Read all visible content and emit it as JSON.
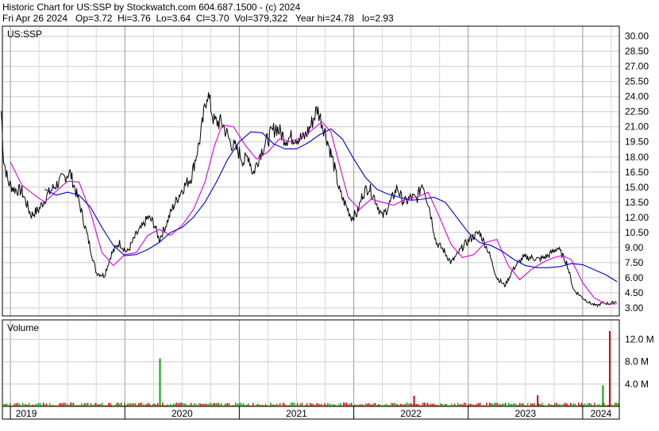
{
  "header": {
    "line1": "Historic Chart for US:SSP by Stockwatch.com 604.687.1500 - (c) 2024",
    "line2": "Fri Apr 26 2024   Op=3.72  Hi=3.76  Lo=3.64  Cl=3.70  Vol=379,322   Year hi=24.78   lo=2.93"
  },
  "chart_data": [
    {
      "type": "line",
      "title": "US:SSP",
      "ylim": [
        2.2,
        31.0
      ],
      "y_ticks": [
        "30.00",
        "28.50",
        "27.00",
        "25.50",
        "24.00",
        "22.50",
        "21.00",
        "19.50",
        "18.00",
        "16.50",
        "15.00",
        "13.50",
        "12.00",
        "10.50",
        "9.00",
        "7.50",
        "6.00",
        "4.50",
        "3.00"
      ],
      "x_labels": [
        "2019",
        "2020",
        "2021",
        "2022",
        "2023",
        "2024"
      ],
      "grid": true,
      "colors": {
        "price": "#000000",
        "ma_short": "#dd00dd",
        "ma_long": "#0000cc"
      },
      "series": [
        {
          "role": "price",
          "x": [
            2018.92,
            2018.94,
            2018.98,
            2019.03,
            2019.1,
            2019.18,
            2019.25,
            2019.32,
            2019.38,
            2019.45,
            2019.52,
            2019.6,
            2019.68,
            2019.75,
            2019.82,
            2019.88,
            2019.95,
            2020.02,
            2020.1,
            2020.15,
            2020.2,
            2020.25,
            2020.3,
            2020.35,
            2020.42,
            2020.5,
            2020.58,
            2020.66,
            2020.72,
            2020.78,
            2020.85,
            2020.92,
            2021.0,
            2021.04,
            2021.08,
            2021.12,
            2021.18,
            2021.25,
            2021.32,
            2021.4,
            2021.48,
            2021.56,
            2021.62,
            2021.68,
            2021.75,
            2021.82,
            2021.88,
            2021.93,
            2021.98,
            2022.03,
            2022.08,
            2022.13,
            2022.18,
            2022.25,
            2022.32,
            2022.38,
            2022.42,
            2022.45,
            2022.5,
            2022.55,
            2022.6,
            2022.66,
            2022.72,
            2022.78,
            2022.85,
            2022.9,
            2022.96,
            2023.03,
            2023.1,
            2023.18,
            2023.25,
            2023.32,
            2023.4,
            2023.48,
            2023.56,
            2023.62,
            2023.7,
            2023.78,
            2023.86,
            2023.92,
            2024.0,
            2024.06,
            2024.12,
            2024.18,
            2024.24,
            2024.3
          ],
          "values": [
            22.6,
            17.8,
            15.5,
            14.8,
            14.6,
            12.2,
            12.8,
            14.2,
            15.0,
            15.8,
            16.5,
            13.5,
            9.8,
            6.5,
            6.2,
            8.3,
            9.5,
            8.5,
            10.3,
            11.0,
            12.0,
            11.5,
            9.8,
            11.0,
            13.0,
            14.8,
            16.0,
            20.0,
            24.5,
            21.5,
            21.4,
            19.5,
            18.4,
            17.5,
            18.2,
            16.3,
            18.3,
            19.8,
            21.0,
            19.8,
            20.0,
            19.8,
            21.0,
            22.8,
            20.5,
            17.5,
            14.4,
            13.2,
            12.0,
            12.4,
            14.4,
            15.0,
            14.0,
            12.0,
            13.5,
            15.0,
            13.8,
            13.5,
            14.0,
            13.8,
            15.5,
            13.0,
            9.5,
            8.8,
            7.5,
            8.2,
            9.2,
            10.0,
            10.5,
            8.5,
            6.0,
            5.2,
            7.0,
            8.0,
            8.0,
            7.8,
            8.2,
            9.0,
            7.5,
            4.8,
            4.0,
            3.5,
            3.2,
            3.5,
            3.4,
            3.7
          ]
        },
        {
          "role": "ma_short",
          "x": [
            2019.0,
            2019.1,
            2019.2,
            2019.3,
            2019.4,
            2019.5,
            2019.6,
            2019.7,
            2019.8,
            2019.9,
            2020.0,
            2020.1,
            2020.2,
            2020.3,
            2020.4,
            2020.5,
            2020.6,
            2020.7,
            2020.78,
            2020.85,
            2020.95,
            2021.05,
            2021.15,
            2021.25,
            2021.35,
            2021.45,
            2021.55,
            2021.65,
            2021.72,
            2021.8,
            2021.88,
            2021.95,
            2022.05,
            2022.15,
            2022.25,
            2022.35,
            2022.45,
            2022.55,
            2022.65,
            2022.75,
            2022.85,
            2022.95,
            2023.05,
            2023.15,
            2023.25,
            2023.35,
            2023.45,
            2023.55,
            2023.65,
            2023.75,
            2023.82,
            2023.9,
            2024.0,
            2024.1,
            2024.2,
            2024.3
          ],
          "values": [
            17.5,
            15.2,
            14.3,
            13.5,
            14.6,
            15.6,
            15.5,
            12.5,
            8.5,
            7.2,
            8.3,
            8.5,
            10.2,
            10.8,
            10.2,
            11.2,
            12.8,
            15.5,
            19.0,
            21.2,
            21.0,
            19.2,
            17.8,
            18.5,
            19.8,
            19.5,
            20.0,
            20.8,
            21.5,
            20.5,
            17.0,
            14.0,
            12.8,
            13.8,
            13.5,
            13.2,
            13.8,
            14.0,
            14.5,
            12.0,
            9.3,
            8.0,
            8.3,
            9.5,
            9.8,
            7.2,
            5.8,
            6.8,
            7.5,
            8.0,
            8.2,
            7.8,
            5.5,
            4.0,
            3.4,
            3.4
          ]
        },
        {
          "role": "ma_long",
          "x": [
            2019.3,
            2019.4,
            2019.5,
            2019.6,
            2019.7,
            2019.8,
            2019.9,
            2020.0,
            2020.1,
            2020.2,
            2020.3,
            2020.4,
            2020.5,
            2020.6,
            2020.7,
            2020.8,
            2020.9,
            2021.0,
            2021.1,
            2021.2,
            2021.3,
            2021.4,
            2021.5,
            2021.6,
            2021.7,
            2021.8,
            2021.9,
            2022.0,
            2022.1,
            2022.2,
            2022.3,
            2022.4,
            2022.5,
            2022.6,
            2022.7,
            2022.8,
            2022.9,
            2023.0,
            2023.1,
            2023.2,
            2023.3,
            2023.4,
            2023.5,
            2023.6,
            2023.7,
            2023.8,
            2023.9,
            2024.0,
            2024.1,
            2024.2,
            2024.3
          ],
          "values": [
            14.8,
            14.2,
            14.5,
            14.2,
            13.0,
            11.0,
            9.2,
            8.2,
            8.3,
            8.8,
            9.5,
            10.5,
            11.0,
            12.0,
            13.5,
            15.5,
            17.8,
            19.5,
            20.5,
            20.4,
            19.3,
            18.8,
            18.8,
            19.4,
            20.2,
            20.8,
            19.8,
            17.8,
            16.0,
            14.8,
            14.3,
            14.0,
            13.7,
            13.8,
            14.0,
            13.5,
            12.0,
            10.5,
            9.5,
            9.2,
            8.6,
            7.8,
            7.2,
            7.0,
            7.0,
            7.1,
            7.4,
            7.3,
            6.8,
            6.3,
            5.6
          ]
        }
      ]
    },
    {
      "type": "bar",
      "title": "Volume",
      "ylim": [
        0,
        15.5
      ],
      "y_ticks": [
        "12.0 M",
        "8.0 M",
        "4.0 M"
      ],
      "colors": {
        "up": "#00aa00",
        "down": "#dd0000",
        "baseline": "#cc6666"
      },
      "notable_bars": [
        {
          "x": 2020.3,
          "value": 8.6,
          "color": "up"
        },
        {
          "x": 2024.23,
          "value": 13.5,
          "color": "down"
        },
        {
          "x": 2024.17,
          "value": 3.8,
          "color": "up"
        },
        {
          "x": 2023.6,
          "value": 2.0,
          "color": "down"
        },
        {
          "x": 2022.52,
          "value": 1.9,
          "color": "down"
        }
      ]
    }
  ]
}
